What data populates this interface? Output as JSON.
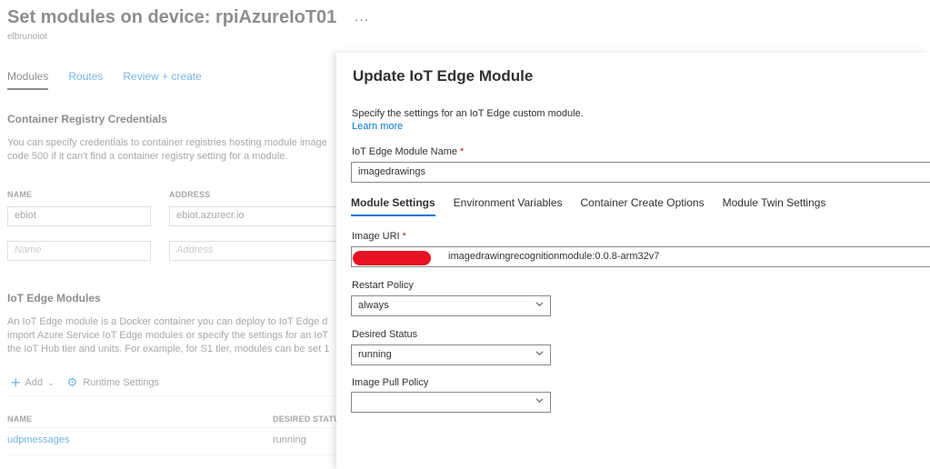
{
  "page": {
    "title": "Set modules on device: rpiAzureIoT01",
    "ellipsis": "···",
    "subtitle": "elbrunoiot",
    "tabs": [
      "Modules",
      "Routes",
      "Review + create"
    ]
  },
  "registry": {
    "title": "Container Registry Credentials",
    "desc_line1": "You can specify credentials to container registries hosting module image",
    "desc_line2": "code 500 if it can't find a container registry setting for a module.",
    "col_name": "NAME",
    "col_address": "ADDRESS",
    "row1_name": "ebiot",
    "row1_address": "ebiot.azurecr.io",
    "name_placeholder": "Name",
    "address_placeholder": "Address"
  },
  "edge_modules": {
    "title": "IoT Edge Modules",
    "desc_line1": "An IoT Edge module is a Docker container you can deploy to IoT Edge d",
    "desc_line2": "import Azure Service IoT Edge modules or specify the settings for an IoT",
    "desc_line3": "the IoT Hub tier and units. For example, for S1 tier, modules can be set 1",
    "add_label": "Add",
    "runtime_label": "Runtime Settings",
    "col_name": "NAME",
    "col_status": "DESIRED STATUS",
    "row1_name": "udpmessages",
    "row1_status": "running"
  },
  "blade": {
    "title": "Update IoT Edge Module",
    "description": "Specify the settings for an IoT Edge custom module.",
    "learn_more": "Learn more",
    "module_name_label": "IoT Edge Module Name",
    "module_name_value": "imagedrawings",
    "required_mark": "*",
    "tabs": [
      "Module Settings",
      "Environment Variables",
      "Container Create Options",
      "Module Twin Settings"
    ],
    "image_uri_label": "Image URI",
    "image_uri_value": "imagedrawingrecognitionmodule:0.0.8-arm32v7",
    "restart_policy_label": "Restart Policy",
    "restart_policy_value": "always",
    "desired_status_label": "Desired Status",
    "desired_status_value": "running",
    "pull_policy_label": "Image Pull Policy",
    "pull_policy_value": ""
  },
  "colors": {
    "accent": "#0078d4",
    "redaction": "#e81123",
    "required": "#a4262c"
  }
}
